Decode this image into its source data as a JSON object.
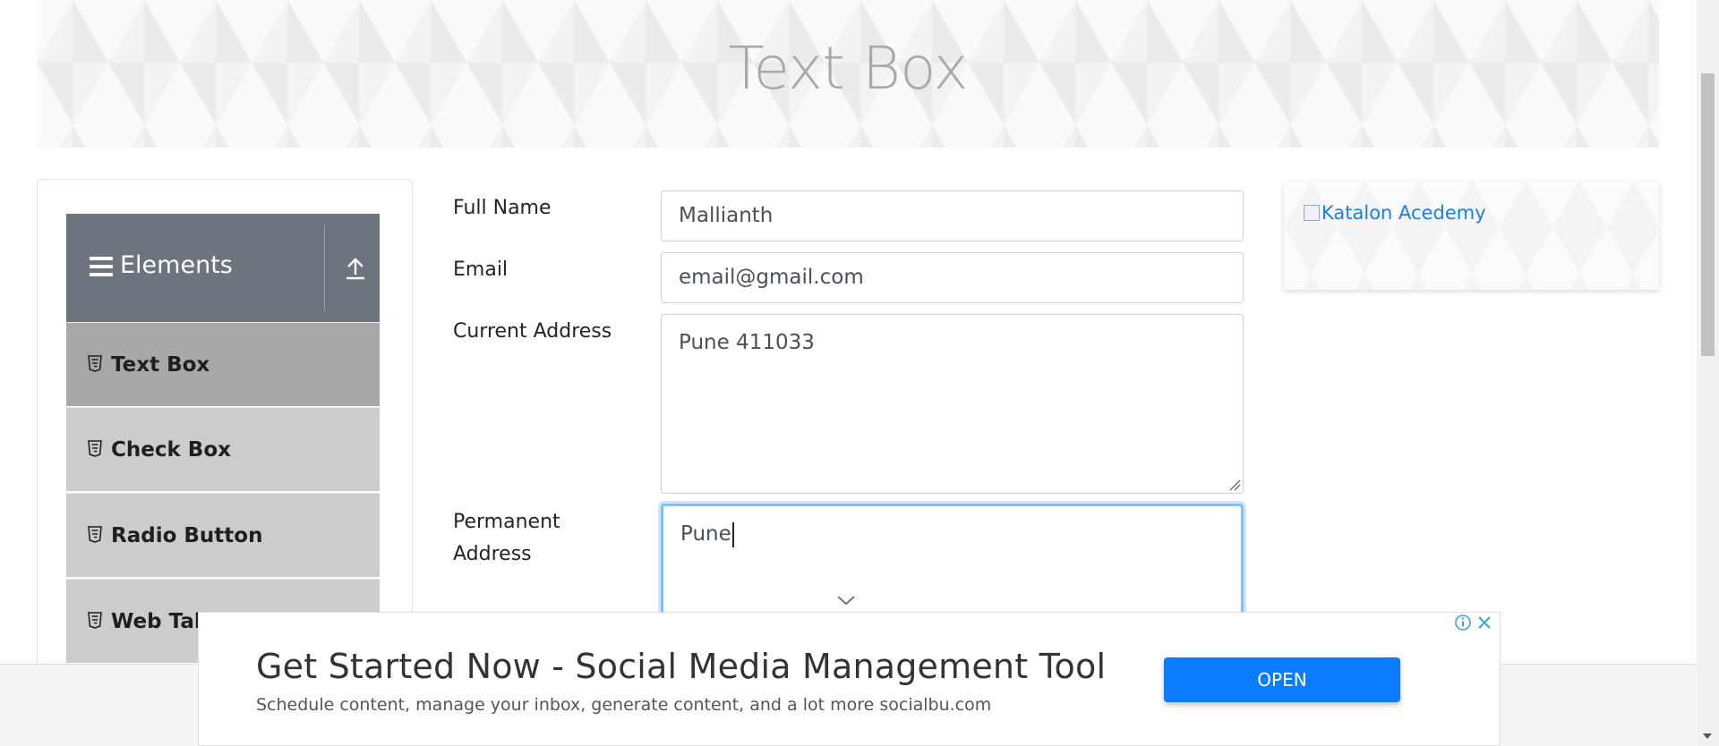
{
  "header": {
    "title": "Text Box"
  },
  "sidebar": {
    "group_title": "Elements",
    "items": [
      {
        "label": "Text Box",
        "active": true
      },
      {
        "label": "Check Box",
        "active": false
      },
      {
        "label": "Radio Button",
        "active": false
      },
      {
        "label": "Web Tab",
        "active": false
      }
    ]
  },
  "form": {
    "full_name": {
      "label": "Full Name",
      "value": "Mallianth"
    },
    "email": {
      "label": "Email",
      "value": "email@gmail.com"
    },
    "current_address": {
      "label": "Current Address",
      "value": "Pune 411033"
    },
    "permanent_address": {
      "label_line1": "Permanent",
      "label_line2": "Address",
      "value": "Pune"
    }
  },
  "right_ad": {
    "alt_text": "Katalon Acedemy"
  },
  "ad_banner": {
    "title": "Get Started Now - Social Media Management Tool",
    "description": "Schedule content, manage your inbox, generate content, and a lot more socialbu.com",
    "button_label": "OPEN"
  },
  "colors": {
    "sidebar_header": "#6c757d",
    "active_item": "#a8a8a8",
    "item": "#cccccc",
    "ad_button": "#0a7cff",
    "focus_border": "#80bdff"
  }
}
